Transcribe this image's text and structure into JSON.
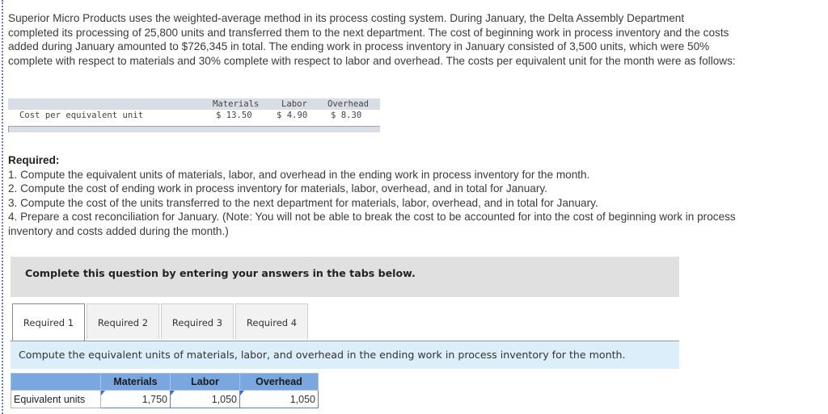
{
  "intro_text": "Superior Micro Products uses the weighted-average method in its process costing system. During January, the Delta Assembly Department completed its processing of 25,800 units and transferred them to the next department. The cost of beginning work in process inventory and the costs added during January amounted to $726,345 in total. The ending work in process inventory in January consisted of 3,500 units, which were 50% complete with respect to materials and 30% complete with respect to labor and overhead. The costs per equivalent unit for the month were as follows:",
  "cost_table": {
    "headers": [
      "Materials",
      "Labor",
      "Overhead"
    ],
    "row_label": "Cost per equivalent unit",
    "values": [
      "$ 13.50",
      "$ 4.90",
      "$ 8.30"
    ]
  },
  "required": {
    "title": "Required:",
    "items": [
      "1. Compute the equivalent units of materials, labor, and overhead in the ending work in process inventory for the month.",
      "2. Compute the cost of ending work in process inventory for materials, labor, overhead, and in total for January.",
      "3. Compute the cost of the units transferred to the next department for materials, labor, overhead, and in total for January.",
      "4. Prepare a cost reconciliation for January. (Note: You will not be able to break the cost to be accounted for into the cost of beginning work in process inventory and costs added during the month.)"
    ]
  },
  "instructions": "Complete this question by entering your answers in the tabs below.",
  "tabs": [
    {
      "label": "Required 1",
      "active": true
    },
    {
      "label": "Required 2",
      "active": false
    },
    {
      "label": "Required 3",
      "active": false
    },
    {
      "label": "Required 4",
      "active": false
    }
  ],
  "tab_panel_text": "Compute the equivalent units of materials, labor, and overhead in the ending work in process inventory for the month.",
  "answer_table": {
    "headers": [
      "",
      "Materials",
      "Labor",
      "Overhead"
    ],
    "row_label": "Equivalent units",
    "values": [
      "1,750",
      "1,050",
      "1,050"
    ]
  },
  "colors": {
    "header_blue": "#7aa7e0",
    "panel_blue": "#ddeefb",
    "instruction_gray": "#e0e0e0"
  }
}
